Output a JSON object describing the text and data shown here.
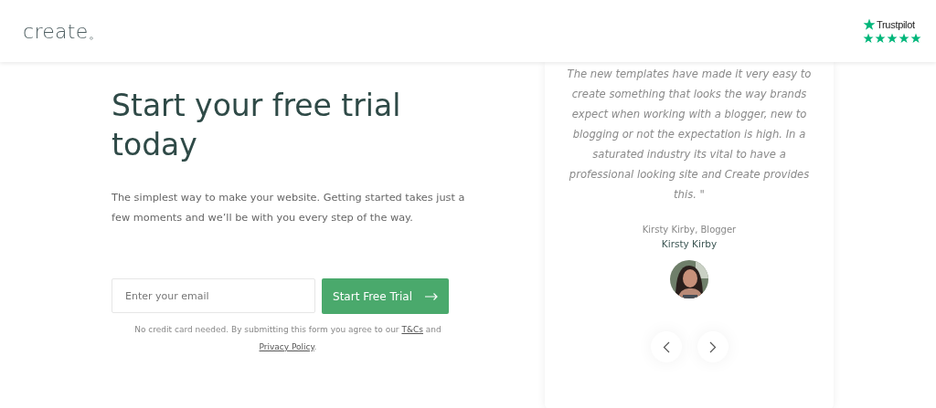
{
  "header": {
    "logo": "create",
    "logo_dot": "。",
    "rating": {
      "brand": "Trustpilot",
      "stars": 5
    }
  },
  "hero": {
    "title": "Start your free trial today",
    "subtitle": "The simplest way to make your website. Getting started takes just a few moments and we’ll be with you every step of the way."
  },
  "signup": {
    "email": {
      "placeholder": "Enter your email"
    },
    "button": "Start Free Trial",
    "note_before": "No credit card needed. By submitting this form you agree to our",
    "terms_link": "T&Cs",
    "note_and": "and",
    "privacy_link": "Privacy Policy",
    "note_end": "."
  },
  "testimonial": {
    "quote": "The new templates have made it very easy to create something that looks the way brands expect when working with a blogger, new to blogging or not the expectation is high. In a saturated industry its vital to have a professional looking site and Create provides this. \"",
    "author_role": "Kirsty Kirby, Blogger",
    "author_name": "Kirsty Kirby"
  }
}
